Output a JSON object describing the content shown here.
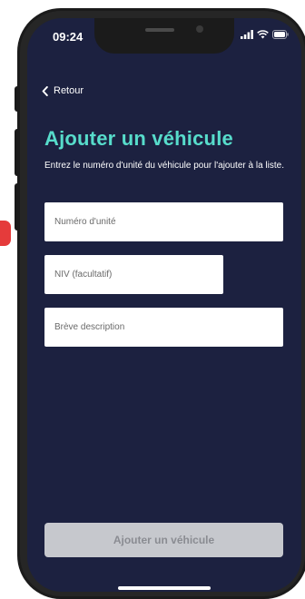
{
  "status_bar": {
    "time": "09:24",
    "icons": [
      "signal-icon",
      "wifi-icon",
      "battery-icon"
    ]
  },
  "nav": {
    "back_label": "Retour",
    "back_icon": "chevron-left-icon"
  },
  "page": {
    "title": "Ajouter un véhicule",
    "subtitle": "Entrez le numéro d'unité du véhicule pour l'ajouter à la liste."
  },
  "form": {
    "unit_number_placeholder": "Numéro d'unité",
    "vin_placeholder": "NIV (facultatif)",
    "description_placeholder": "Brève description"
  },
  "actions": {
    "submit_label": "Ajouter un véhicule"
  },
  "colors": {
    "screen_background": "#1c2140",
    "title_accent": "#57dccb",
    "button_disabled_bg": "#c6c8cd",
    "button_disabled_text": "#8a8c92",
    "marker_red": "#e53b3b"
  }
}
